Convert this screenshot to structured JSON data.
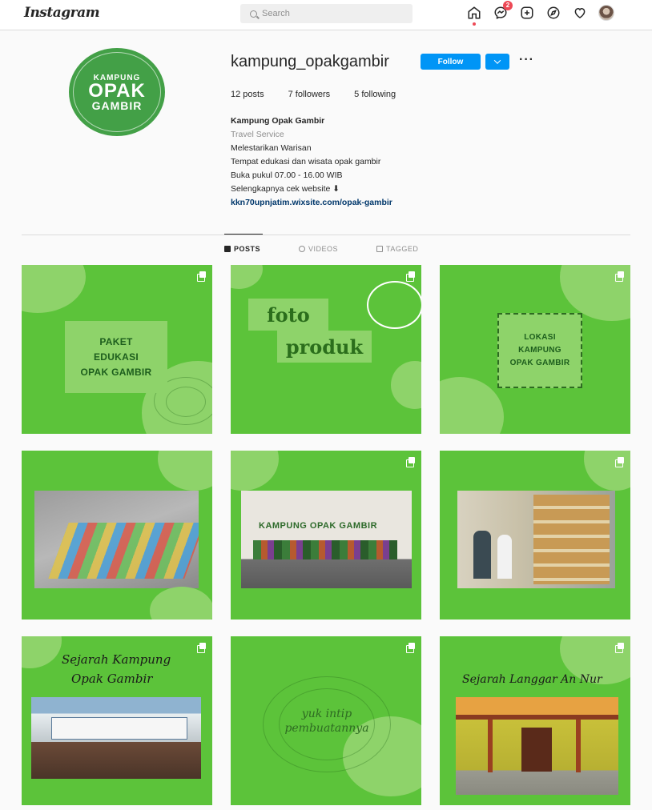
{
  "topnav": {
    "logo": "Instagram",
    "search_placeholder": "Search",
    "notifications_count": "2",
    "icons": [
      "home-icon",
      "messenger-icon",
      "new-post-icon",
      "explore-icon",
      "heart-icon",
      "avatar"
    ]
  },
  "profile": {
    "picture_text": [
      "KAMPUNG",
      "OPAK",
      "GAMBIR"
    ],
    "username": "kampung_opakgambir",
    "follow_label": "Follow",
    "more_label": "···",
    "stats": {
      "posts": "12 posts",
      "followers": "7 followers",
      "following": "5 following"
    },
    "bio": {
      "name": "Kampung Opak Gambir",
      "category": "Travel Service",
      "lines": [
        "Melestarikan Warisan",
        "Tempat edukasi dan wisata opak gambir",
        "Buka pukul 07.00 - 16.00 WIB",
        "Selengkapnya cek website ⬇"
      ],
      "link": "kkn70upnjatim.wixsite.com/opak-gambir"
    }
  },
  "tabs": [
    {
      "label": "POSTS",
      "icon": "grid-icon",
      "active": true
    },
    {
      "label": "VIDEOS",
      "icon": "video-icon",
      "active": false
    },
    {
      "label": "TAGGED",
      "icon": "tag-icon",
      "active": false
    }
  ],
  "posts": {
    "p1": {
      "lines": [
        "PAKET",
        "EDUKASI",
        "OPAK GAMBIR"
      ]
    },
    "p2": {
      "line1": "foto",
      "line2": "produk"
    },
    "p3": {
      "lines": [
        "LOKASI",
        "KAMPUNG",
        "OPAK GAMBIR"
      ]
    },
    "p5": {
      "sign": "KAMPUNG OPAK GAMBIR"
    },
    "p7": {
      "line1": "Sejarah Kampung",
      "line2": "Opak Gambir"
    },
    "p8": {
      "line1": "yuk intip",
      "line2": "pembuatannya"
    },
    "p9": {
      "title": "Sejarah Langgar An Nur"
    }
  },
  "colors": {
    "post_green": "#5cc33a",
    "follow_blue": "#0095f6",
    "link_blue": "#00376b"
  }
}
